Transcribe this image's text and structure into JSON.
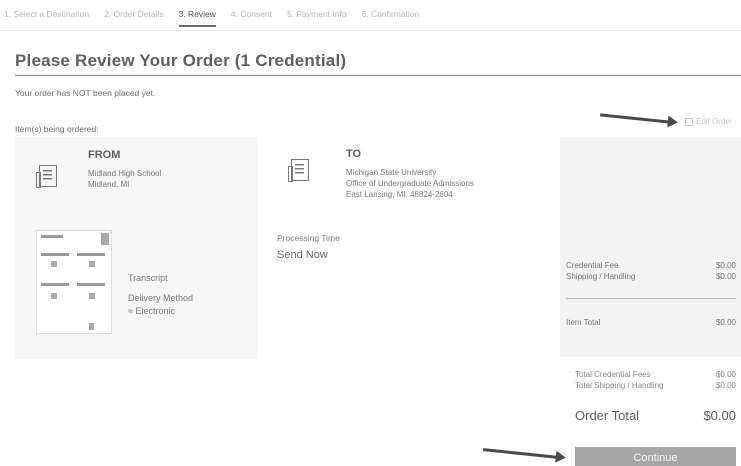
{
  "steps": [
    {
      "label": "1. Select a Destination"
    },
    {
      "label": "2. Order Details"
    },
    {
      "label": "3. Review"
    },
    {
      "label": "4. Consent"
    },
    {
      "label": "5. Payment Info"
    },
    {
      "label": "6. Confirmation"
    }
  ],
  "active_step": "3. Review",
  "page": {
    "title": "Please Review Your Order (1 Credential)",
    "notice": "Your order has NOT been placed yet.",
    "items_label": "Item(s) being ordered:",
    "edit_order": "Edit Order"
  },
  "from": {
    "heading": "FROM",
    "name": "Midland High School",
    "location": "Midland, MI"
  },
  "to": {
    "heading": "TO",
    "line1": "Michigan State University",
    "line2": "Office of Undergraduate Admissions",
    "line3": "East Lansing, MI, 48824-2604"
  },
  "document": {
    "type": "Transcript",
    "delivery_label": "Delivery Method",
    "delivery_value": "Electronic"
  },
  "processing": {
    "label": "Processing Time",
    "value": "Send Now"
  },
  "summary": {
    "credential_fee_label": "Credential Fee",
    "credential_fee": "$0.00",
    "shipping_label": "Shipping / Handling",
    "shipping": "$0.00",
    "item_total_label": "Item Total",
    "item_total": "$0.00"
  },
  "totals": {
    "total_credential_label": "Total Credential Fees",
    "total_credential": "$0.00",
    "total_shipping_label": "Total Shipping / Handling",
    "total_shipping": "$0.00",
    "order_total_label": "Order Total",
    "order_total": "$0.00"
  },
  "continue_label": "Continue"
}
